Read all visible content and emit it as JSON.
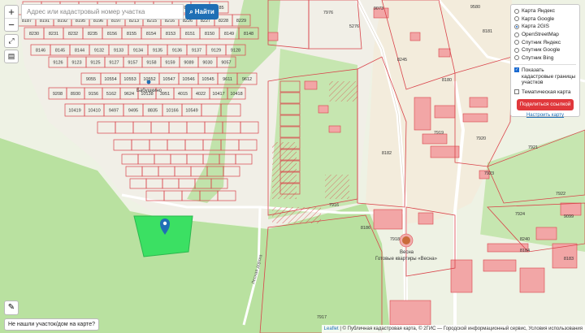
{
  "search": {
    "placeholder": "Адрес или кадастровый номер участка",
    "find_label": "Найти"
  },
  "zoom": {
    "in_label": "+",
    "out_label": "−"
  },
  "layers": {
    "options": [
      {
        "label": "Карта Яндекс",
        "selected": false
      },
      {
        "label": "Карта Google",
        "selected": false
      },
      {
        "label": "Карта 2GIS",
        "selected": true
      },
      {
        "label": "OpenStreetMap",
        "selected": false
      },
      {
        "label": "Спутник Яндекс",
        "selected": false
      },
      {
        "label": "Спутник Google",
        "selected": false
      },
      {
        "label": "Спутник Bing",
        "selected": false
      }
    ],
    "show_cadastral_label": "Показать кадастровые границы участков",
    "show_cadastral_checked": true,
    "thematic_label": "Тематическая карта",
    "thematic_checked": false,
    "share_label": "Поделиться ссылкой",
    "configure_label": "Настроить карту"
  },
  "not_found_label": "Не нашли участок/дом на карте?",
  "attribution": {
    "leaflet": "Leaflet",
    "rest": " | © Публичная кадастровая карта, © 2ГИС — Городской информационный сервис, Условия использования"
  },
  "map": {
    "plot_numbers": [
      "9073",
      "7976",
      "5276",
      "9580",
      "8245",
      "8180",
      "8181",
      "8182",
      "7919",
      "7920",
      "7921",
      "7922",
      "7923",
      "7924",
      "9099",
      "8240",
      "8184",
      "8183",
      "8186",
      "7918",
      "7916",
      "7917",
      "8233",
      "8234",
      "8236",
      "8237",
      "8238",
      "7914",
      "7915",
      "8188",
      "8189",
      "8190",
      "8185",
      "8187",
      "8191",
      "8192",
      "8195",
      "8196",
      "8197",
      "8213",
      "8215",
      "8216",
      "8226",
      "8227",
      "8228",
      "8229",
      "8230",
      "8231",
      "8232",
      "8235",
      "8156",
      "8155",
      "8154",
      "8153",
      "8151",
      "8150",
      "8149",
      "8148",
      "8146",
      "8145",
      "8144",
      "9132",
      "9133",
      "9134",
      "9135",
      "9136",
      "9137",
      "9129",
      "9128",
      "9126",
      "9123",
      "9125",
      "9127",
      "9157",
      "9158",
      "9159",
      "9089",
      "9030",
      "9057",
      "9055",
      "10554",
      "10553",
      "10552",
      "10547",
      "10546",
      "10545",
      "9611",
      "9612",
      "9208",
      "8930",
      "9156",
      "5162",
      "9624",
      "10138",
      "3951",
      "4015",
      "4022",
      "10417",
      "10418",
      "10419",
      "10410",
      "9497",
      "9495",
      "8835",
      "10166",
      "10549"
    ],
    "place_labels": [
      "Бабушкино",
      "Весна",
      "Готовые квартиры «Весна»"
    ],
    "road_label": "Лесная дорога",
    "marker_icon": "map-pin-icon",
    "highlight_color": "#3be063",
    "boundary_color": "#d9434a"
  }
}
